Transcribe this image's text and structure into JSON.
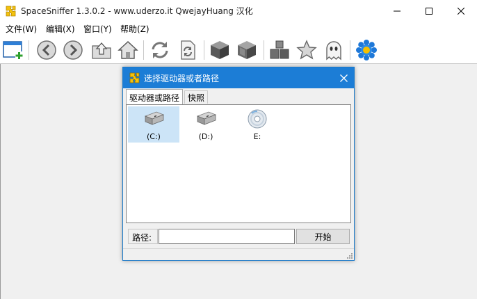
{
  "window": {
    "title": "SpaceSniffer 1.3.0.2 - www.uderzo.it  QwejayHuang 汉化",
    "controls": [
      "minimize-icon",
      "maximize-icon",
      "close-icon"
    ]
  },
  "menu": {
    "items": [
      {
        "label": "文件(W)"
      },
      {
        "label": "编辑(X)"
      },
      {
        "label": "窗口(Y)"
      },
      {
        "label": "帮助(Z)"
      }
    ]
  },
  "toolbar": {
    "buttons": [
      "new-window-icon",
      "back-icon",
      "forward-icon",
      "up-folder-icon",
      "home-icon",
      "refresh-icon",
      "refresh-page-icon",
      "cube-icon",
      "cube-faceted-icon",
      "blocks-icon",
      "star-icon",
      "ghost-icon",
      "settings-flower-icon"
    ]
  },
  "dialog": {
    "title": "选择驱动器或者路径",
    "tabs": [
      {
        "label": "驱动器或路径",
        "active": true
      },
      {
        "label": "快照",
        "active": false
      }
    ],
    "drives": [
      {
        "label": "(C:)",
        "icon": "hard-drive-icon",
        "selected": true
      },
      {
        "label": "(D:)",
        "icon": "hard-drive-icon",
        "selected": false
      },
      {
        "label": "E:",
        "icon": "cd-drive-icon",
        "selected": false
      }
    ],
    "path_label": "路径:",
    "path_value": "",
    "start_label": "开始"
  },
  "colors": {
    "accent": "#1c7dd6",
    "selection": "#cce4f7",
    "workspace": "#f0f0f0"
  }
}
